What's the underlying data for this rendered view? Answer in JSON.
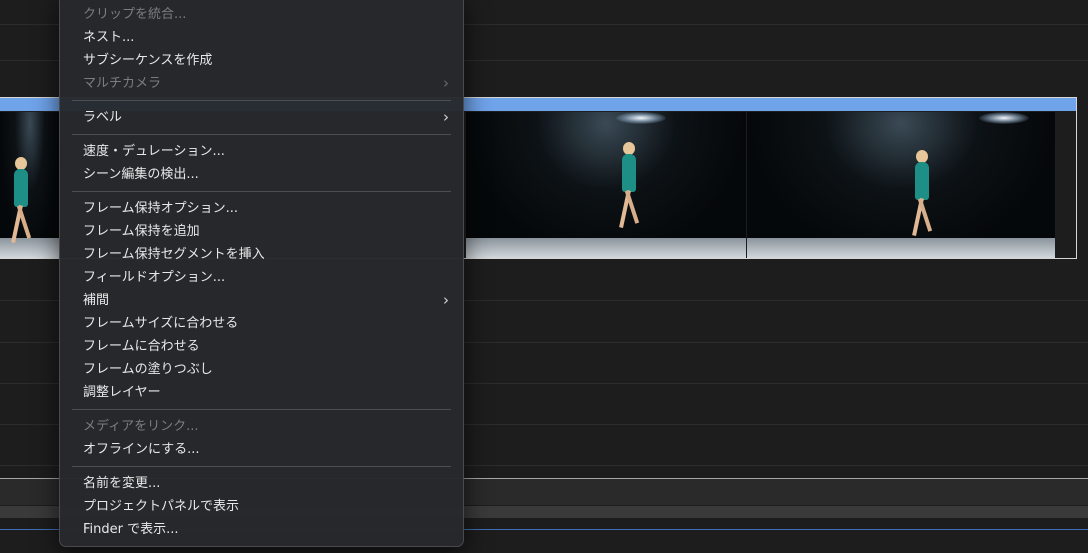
{
  "context_menu": {
    "items": [
      {
        "type": "item",
        "label": "クリップを統合...",
        "enabled": false,
        "submenu": false
      },
      {
        "type": "item",
        "label": "ネスト...",
        "enabled": true,
        "submenu": false
      },
      {
        "type": "item",
        "label": "サブシーケンスを作成",
        "enabled": true,
        "submenu": false
      },
      {
        "type": "item",
        "label": "マルチカメラ",
        "enabled": false,
        "submenu": true
      },
      {
        "type": "separator"
      },
      {
        "type": "item",
        "label": "ラベル",
        "enabled": true,
        "submenu": true
      },
      {
        "type": "separator"
      },
      {
        "type": "item",
        "label": "速度・デュレーション...",
        "enabled": true,
        "submenu": false
      },
      {
        "type": "item",
        "label": "シーン編集の検出...",
        "enabled": true,
        "submenu": false
      },
      {
        "type": "separator"
      },
      {
        "type": "item",
        "label": "フレーム保持オプション...",
        "enabled": true,
        "submenu": false
      },
      {
        "type": "item",
        "label": "フレーム保持を追加",
        "enabled": true,
        "submenu": false
      },
      {
        "type": "item",
        "label": "フレーム保持セグメントを挿入",
        "enabled": true,
        "submenu": false
      },
      {
        "type": "item",
        "label": "フィールドオプション...",
        "enabled": true,
        "submenu": false
      },
      {
        "type": "item",
        "label": "補間",
        "enabled": true,
        "submenu": true
      },
      {
        "type": "item",
        "label": "フレームサイズに合わせる",
        "enabled": true,
        "submenu": false
      },
      {
        "type": "item",
        "label": "フレームに合わせる",
        "enabled": true,
        "submenu": false
      },
      {
        "type": "item",
        "label": "フレームの塗りつぶし",
        "enabled": true,
        "submenu": false
      },
      {
        "type": "item",
        "label": "調整レイヤー",
        "enabled": true,
        "submenu": false
      },
      {
        "type": "separator"
      },
      {
        "type": "item",
        "label": "メディアをリンク...",
        "enabled": false,
        "submenu": false
      },
      {
        "type": "item",
        "label": "オフラインにする...",
        "enabled": true,
        "submenu": false
      },
      {
        "type": "separator"
      },
      {
        "type": "item",
        "label": "名前を変更...",
        "enabled": true,
        "submenu": false
      },
      {
        "type": "item",
        "label": "プロジェクトパネルで表示",
        "enabled": true,
        "submenu": false
      },
      {
        "type": "item",
        "label": "Finder で表示...",
        "enabled": true,
        "submenu": false
      }
    ],
    "submenu_glyph": "›"
  },
  "timeline": {
    "clip_label_color": "#6fa3ea",
    "thumbnails": [
      {
        "name": "skater-frame-left"
      },
      {
        "name": "skater-frame-jump"
      },
      {
        "name": "skater-frame-spin"
      }
    ]
  }
}
